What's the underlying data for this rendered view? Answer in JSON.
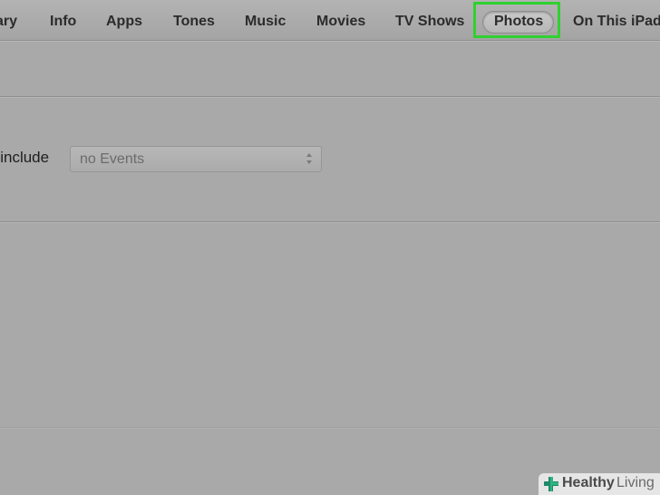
{
  "tabs": [
    {
      "label": "ary"
    },
    {
      "label": "Info"
    },
    {
      "label": "Apps"
    },
    {
      "label": "Tones"
    },
    {
      "label": "Music"
    },
    {
      "label": "Movies"
    },
    {
      "label": "TV Shows"
    },
    {
      "label": "Photos",
      "selected": true
    },
    {
      "label": "On This iPad"
    }
  ],
  "highlight_color": "#2fd12f",
  "photos_section": {
    "include_label": "y include",
    "events_select": {
      "value": "no Events",
      "icon": "up-down-arrows-icon"
    }
  },
  "watermark": {
    "brand_bold": "Healthy",
    "brand_light": "Living",
    "icon": "medical-cross-icon",
    "accent_color": "#1f8a6a"
  }
}
